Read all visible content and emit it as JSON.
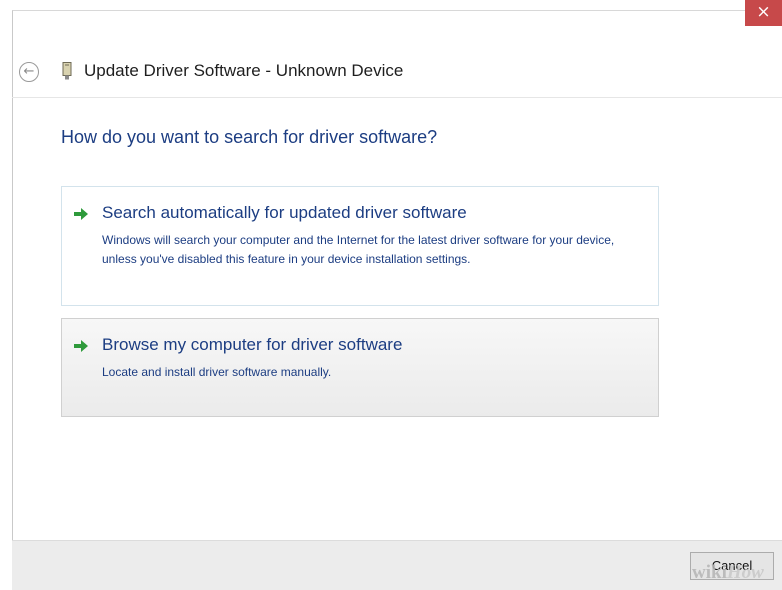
{
  "window": {
    "title": "Update Driver Software - Unknown Device",
    "close_label": "×"
  },
  "navigation": {
    "back_glyph": "←"
  },
  "main": {
    "heading": "How do you want to search for driver software?",
    "options": [
      {
        "title": "Search automatically for updated driver software",
        "description": "Windows will search your computer and the Internet for the latest driver software for your device, unless you've disabled this feature in your device installation settings."
      },
      {
        "title": "Browse my computer for driver software",
        "description": "Locate and install driver software manually."
      }
    ]
  },
  "footer": {
    "cancel_label": "Cancel"
  },
  "watermark": {
    "text_wiki": "wiki",
    "text_how": "How"
  },
  "colors": {
    "accent_text": "#1c3d82",
    "arrow_green": "#2e9a3b",
    "close_red": "#c7494a"
  },
  "icons": {
    "back": "back-arrow-icon",
    "device": "device-icon",
    "option": "green-arrow-icon",
    "close": "close-icon"
  }
}
